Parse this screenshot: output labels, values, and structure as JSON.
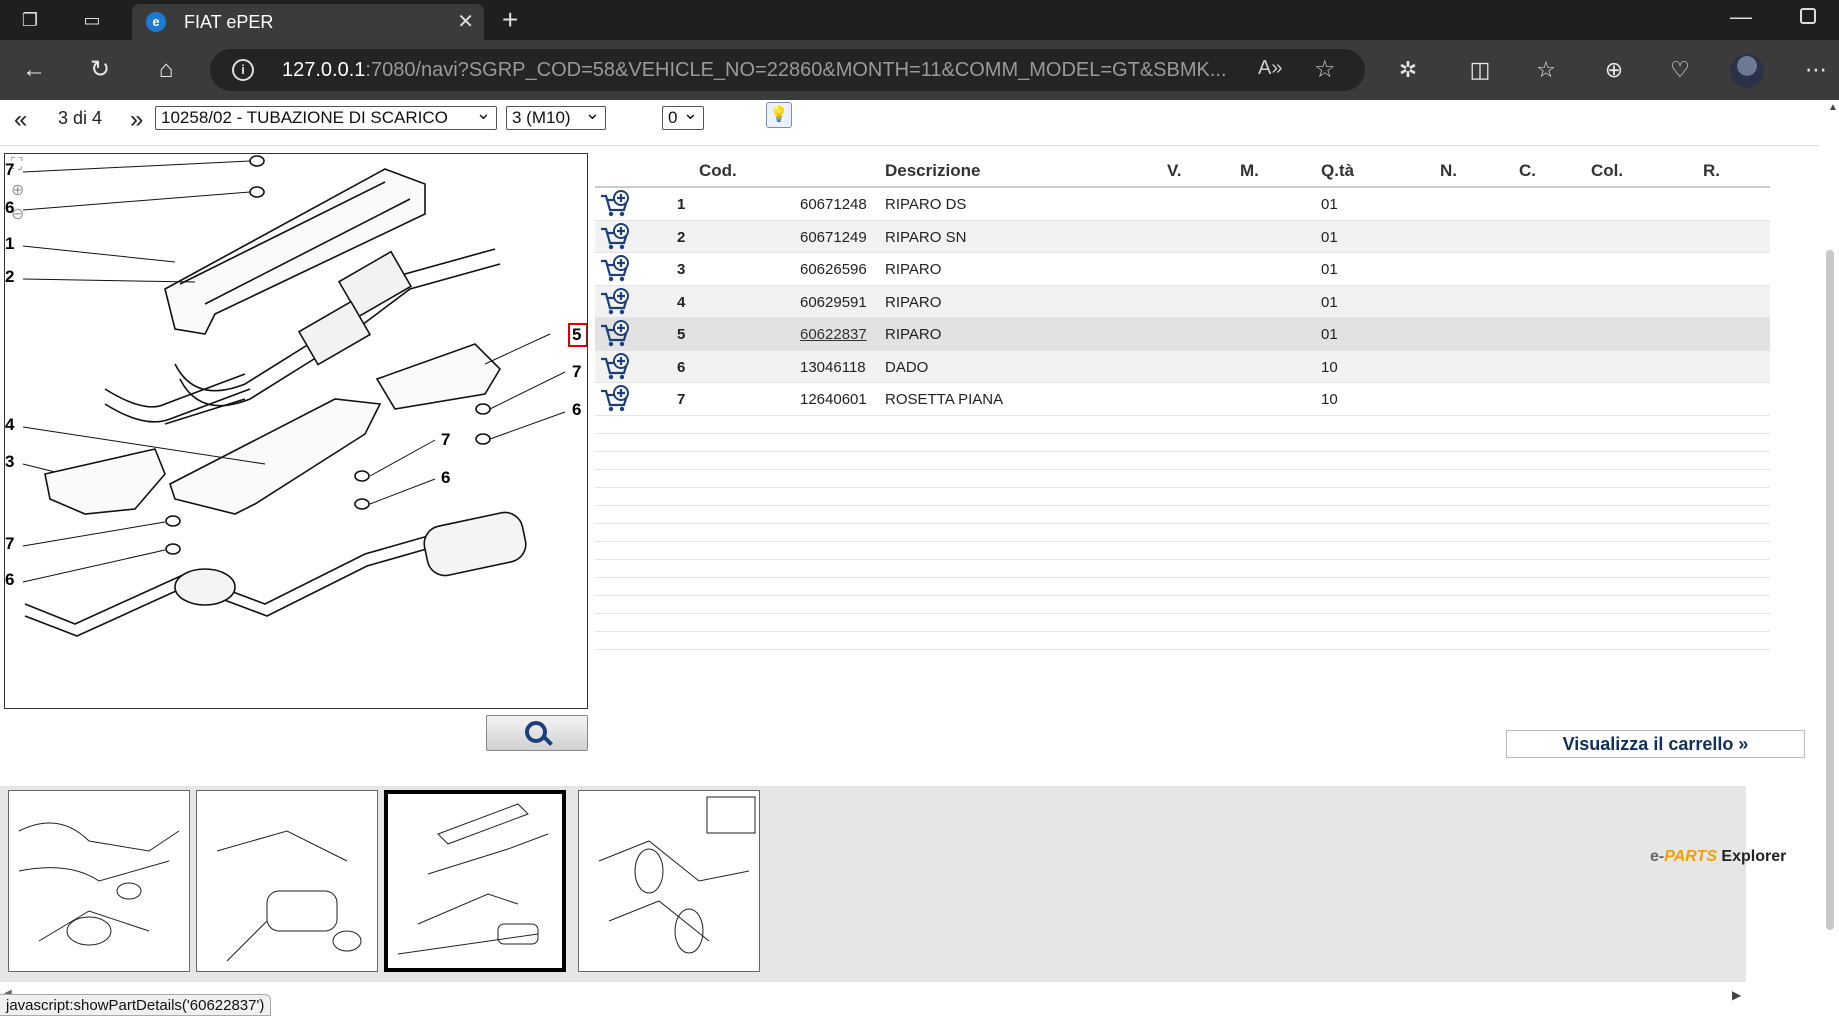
{
  "browser": {
    "tab_title": "FIAT ePER",
    "url_host": "127.0.0.1",
    "url_rest": ":7080/navi?SGRP_COD=58&VEHICLE_NO=22860&MONTH=11&COMM_MODEL=GT&SBMK..."
  },
  "nav": {
    "counter": "3 di 4",
    "group_select": "10258/02 - TUBAZIONE DI SCARICO",
    "variant_select": "3 (M10)",
    "count_select": "0"
  },
  "table": {
    "headers": [
      "Cod.",
      "Descrizione",
      "V.",
      "M.",
      "Q.tà",
      "N.",
      "C.",
      "Col.",
      "R."
    ],
    "rows": [
      {
        "num": "1",
        "code": "60671248",
        "desc": "RIPARO DS",
        "qty": "01"
      },
      {
        "num": "2",
        "code": "60671249",
        "desc": "RIPARO SN",
        "qty": "01"
      },
      {
        "num": "3",
        "code": "60626596",
        "desc": "RIPARO",
        "qty": "01"
      },
      {
        "num": "4",
        "code": "60629591",
        "desc": "RIPARO",
        "qty": "01"
      },
      {
        "num": "5",
        "code": "60622837",
        "desc": "RIPARO",
        "qty": "01"
      },
      {
        "num": "6",
        "code": "13046118",
        "desc": "DADO",
        "qty": "10"
      },
      {
        "num": "7",
        "code": "12640601",
        "desc": "ROSETTA PIANA",
        "qty": "10"
      }
    ]
  },
  "drawing": {
    "callouts_left": [
      "7",
      "6",
      "1",
      "2",
      "4",
      "3",
      "7",
      "6"
    ],
    "callouts_right": [
      "5",
      "7",
      "6",
      "7",
      "6"
    ]
  },
  "cart_button": "Visualizza il carrello »",
  "brand": {
    "e": "e-",
    "parts": "PARTS",
    "explorer": " Explorer"
  },
  "status_text": "javascript:showPartDetails('60622837')"
}
